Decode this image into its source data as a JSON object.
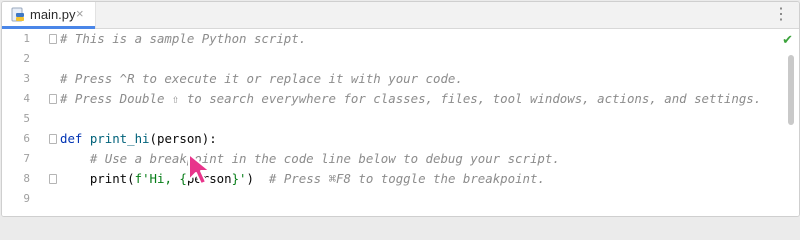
{
  "tab": {
    "filename": "main.py",
    "close_glyph": "×"
  },
  "toolbar": {
    "more_glyph": "⋮"
  },
  "status": {
    "check_glyph": "✔"
  },
  "lines": [
    {
      "num": "1",
      "code": "# This is a sample Python script."
    },
    {
      "num": "2",
      "code": ""
    },
    {
      "num": "3",
      "code": "# Press ^R to execute it or replace it with your code."
    },
    {
      "num": "4",
      "code": "# Press Double ⇧ to search everywhere for classes, files, tool windows, actions, and settings."
    },
    {
      "num": "5",
      "code": ""
    },
    {
      "num": "6",
      "code_parts": {
        "kw": "def ",
        "fn": "print_hi",
        "open": "(",
        "param": "person",
        "close": "):"
      }
    },
    {
      "num": "7",
      "code": "    # Use a breakpoint in the code line below to debug your script."
    },
    {
      "num": "8",
      "code_parts": {
        "indent": "    ",
        "call": "print(",
        "str1": "f'Hi, {",
        "var": "person",
        "str2": "}'",
        "close": ")",
        "gap": "  ",
        "comment": "# Press ⌘F8 to toggle the breakpoint."
      }
    },
    {
      "num": "9",
      "code": ""
    }
  ],
  "icons": {
    "file": "python-file-icon",
    "check": "check-icon",
    "cursor": "mouse-pointer-icon"
  },
  "colors": {
    "tab_underline": "#4a86e8",
    "keyword": "#0033b3",
    "function": "#00627a",
    "string": "#067d17",
    "comment": "#8c8c8c",
    "check": "#3ca33c",
    "cursor": "#e8358b"
  }
}
